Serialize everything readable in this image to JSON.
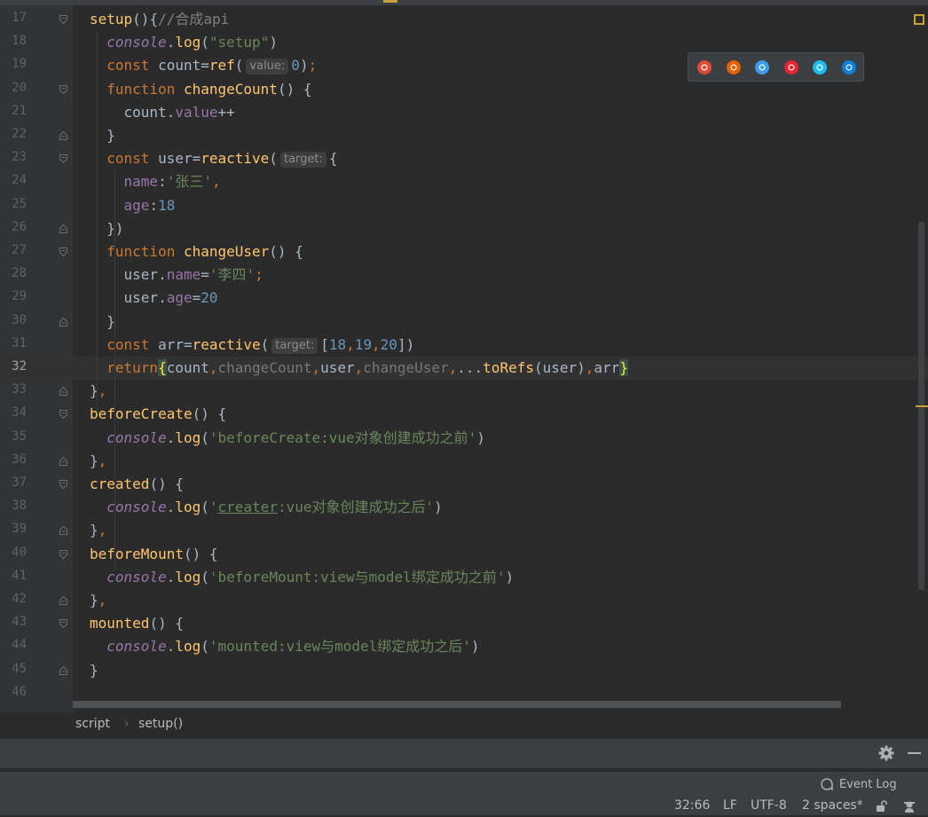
{
  "editor": {
    "current_line": 32,
    "lines": [
      {
        "n": 17,
        "tokens": [
          [
            "fn",
            "setup"
          ],
          [
            "def",
            "(){"
          ],
          [
            "cmt",
            "//合成api"
          ]
        ]
      },
      {
        "n": 18,
        "tokens": [
          [
            "sp",
            "  "
          ],
          [
            "con",
            "console"
          ],
          [
            "def",
            "."
          ],
          [
            "fn",
            "log"
          ],
          [
            "def",
            "("
          ],
          [
            "str",
            "\"setup\""
          ],
          [
            "def",
            ")"
          ]
        ]
      },
      {
        "n": 19,
        "tokens": [
          [
            "sp",
            "  "
          ],
          [
            "kw",
            "const "
          ],
          [
            "def",
            "count="
          ],
          [
            "fn",
            "ref"
          ],
          [
            "def",
            "("
          ],
          [
            "hint",
            "value:"
          ],
          [
            "num",
            "0"
          ],
          [
            "def",
            ")"
          ],
          [
            "kw",
            ";"
          ]
        ]
      },
      {
        "n": 20,
        "tokens": [
          [
            "sp",
            "  "
          ],
          [
            "kw",
            "function "
          ],
          [
            "fn",
            "changeCount"
          ],
          [
            "def",
            "() {"
          ]
        ]
      },
      {
        "n": 21,
        "tokens": [
          [
            "sp",
            "    "
          ],
          [
            "def",
            "count."
          ],
          [
            "prop",
            "value"
          ],
          [
            "def",
            "++"
          ]
        ]
      },
      {
        "n": 22,
        "tokens": [
          [
            "sp",
            "  "
          ],
          [
            "def",
            "}"
          ]
        ]
      },
      {
        "n": 23,
        "tokens": [
          [
            "sp",
            "  "
          ],
          [
            "kw",
            "const "
          ],
          [
            "def",
            "user="
          ],
          [
            "fn",
            "reactive"
          ],
          [
            "def",
            "("
          ],
          [
            "hint",
            "target:"
          ],
          [
            "def",
            "{"
          ]
        ]
      },
      {
        "n": 24,
        "tokens": [
          [
            "sp",
            "    "
          ],
          [
            "prop",
            "name"
          ],
          [
            "def",
            ":"
          ],
          [
            "str",
            "'张三'"
          ],
          [
            "kw",
            ","
          ]
        ]
      },
      {
        "n": 25,
        "tokens": [
          [
            "sp",
            "    "
          ],
          [
            "prop",
            "age"
          ],
          [
            "def",
            ":"
          ],
          [
            "num",
            "18"
          ]
        ]
      },
      {
        "n": 26,
        "tokens": [
          [
            "sp",
            "  "
          ],
          [
            "def",
            "})"
          ]
        ]
      },
      {
        "n": 27,
        "tokens": [
          [
            "sp",
            "  "
          ],
          [
            "kw",
            "function "
          ],
          [
            "fn",
            "changeUser"
          ],
          [
            "def",
            "() {"
          ]
        ]
      },
      {
        "n": 28,
        "tokens": [
          [
            "sp",
            "    "
          ],
          [
            "def",
            "user."
          ],
          [
            "prop",
            "name"
          ],
          [
            "def",
            "="
          ],
          [
            "str",
            "'李四'"
          ],
          [
            "kw",
            ";"
          ]
        ]
      },
      {
        "n": 29,
        "tokens": [
          [
            "sp",
            "    "
          ],
          [
            "def",
            "user."
          ],
          [
            "prop",
            "age"
          ],
          [
            "def",
            "="
          ],
          [
            "num",
            "20"
          ]
        ]
      },
      {
        "n": 30,
        "tokens": [
          [
            "sp",
            "  "
          ],
          [
            "def",
            "}"
          ]
        ]
      },
      {
        "n": 31,
        "tokens": [
          [
            "sp",
            "  "
          ],
          [
            "kw",
            "const "
          ],
          [
            "def",
            "arr="
          ],
          [
            "fn",
            "reactive"
          ],
          [
            "def",
            "("
          ],
          [
            "hint",
            "target:"
          ],
          [
            "def",
            "["
          ],
          [
            "num",
            "18"
          ],
          [
            "kw",
            ","
          ],
          [
            "num",
            "19"
          ],
          [
            "kw",
            ","
          ],
          [
            "num",
            "20"
          ],
          [
            "def",
            "])"
          ]
        ]
      },
      {
        "n": 32,
        "tokens": [
          [
            "sp",
            "  "
          ],
          [
            "kw",
            "return"
          ],
          [
            "hl",
            "{"
          ],
          [
            "def",
            "count"
          ],
          [
            "kw",
            ","
          ],
          [
            "dim",
            "changeCount"
          ],
          [
            "kw",
            ","
          ],
          [
            "def",
            "user"
          ],
          [
            "kw",
            ","
          ],
          [
            "dim",
            "changeUser"
          ],
          [
            "kw",
            ","
          ],
          [
            "def",
            "..."
          ],
          [
            "fn",
            "toRefs"
          ],
          [
            "def",
            "(user)"
          ],
          [
            "kw",
            ","
          ],
          [
            "def",
            "arr"
          ],
          [
            "hl",
            "}"
          ]
        ]
      },
      {
        "n": 33,
        "tokens": [
          [
            "def",
            "}"
          ],
          [
            "kw",
            ","
          ]
        ]
      },
      {
        "n": 34,
        "tokens": [
          [
            "fn",
            "beforeCreate"
          ],
          [
            "def",
            "() {"
          ]
        ]
      },
      {
        "n": 35,
        "tokens": [
          [
            "sp",
            "  "
          ],
          [
            "con",
            "console"
          ],
          [
            "def",
            "."
          ],
          [
            "fn",
            "log"
          ],
          [
            "def",
            "("
          ],
          [
            "str",
            "'beforeCreate:vue对象创建成功之前'"
          ],
          [
            "def",
            ")"
          ]
        ]
      },
      {
        "n": 36,
        "tokens": [
          [
            "def",
            "}"
          ],
          [
            "kw",
            ","
          ]
        ]
      },
      {
        "n": 37,
        "tokens": [
          [
            "fn",
            "created"
          ],
          [
            "def",
            "() {"
          ]
        ]
      },
      {
        "n": 38,
        "tokens": [
          [
            "sp",
            "  "
          ],
          [
            "con",
            "console"
          ],
          [
            "def",
            "."
          ],
          [
            "fn",
            "log"
          ],
          [
            "def",
            "("
          ],
          [
            "str",
            "'"
          ],
          [
            "ul",
            "creater"
          ],
          [
            "str",
            ":vue对象创建成功之后'"
          ],
          [
            "def",
            ")"
          ]
        ]
      },
      {
        "n": 39,
        "tokens": [
          [
            "def",
            "}"
          ],
          [
            "kw",
            ","
          ]
        ]
      },
      {
        "n": 40,
        "tokens": [
          [
            "fn",
            "beforeMount"
          ],
          [
            "def",
            "() {"
          ]
        ]
      },
      {
        "n": 41,
        "tokens": [
          [
            "sp",
            "  "
          ],
          [
            "con",
            "console"
          ],
          [
            "def",
            "."
          ],
          [
            "fn",
            "log"
          ],
          [
            "def",
            "("
          ],
          [
            "str",
            "'beforeMount:view与model绑定成功之前'"
          ],
          [
            "def",
            ")"
          ]
        ]
      },
      {
        "n": 42,
        "tokens": [
          [
            "def",
            "}"
          ],
          [
            "kw",
            ","
          ]
        ]
      },
      {
        "n": 43,
        "tokens": [
          [
            "fn",
            "mounted"
          ],
          [
            "def",
            "() {"
          ]
        ]
      },
      {
        "n": 44,
        "tokens": [
          [
            "sp",
            "  "
          ],
          [
            "con",
            "console"
          ],
          [
            "def",
            "."
          ],
          [
            "fn",
            "log"
          ],
          [
            "def",
            "("
          ],
          [
            "str",
            "'mounted:view与model绑定成功之后'"
          ],
          [
            "def",
            ")"
          ]
        ]
      },
      {
        "n": 45,
        "tokens": [
          [
            "def",
            "}"
          ]
        ]
      },
      {
        "n": 46,
        "tokens": []
      }
    ],
    "folds": {
      "17": "open",
      "20": "open",
      "22": "close",
      "23": "open",
      "26": "close",
      "27": "open",
      "30": "close",
      "33": "close",
      "34": "open",
      "36": "close",
      "37": "open",
      "39": "close",
      "40": "open",
      "42": "close",
      "43": "open",
      "45": "close"
    }
  },
  "browser_icons": [
    {
      "name": "chrome-icon",
      "color": "#dd4b39"
    },
    {
      "name": "firefox-icon",
      "color": "#e66000"
    },
    {
      "name": "safari-icon",
      "color": "#3d9be9"
    },
    {
      "name": "opera-icon",
      "color": "#e3262f"
    },
    {
      "name": "internet-explorer-icon",
      "color": "#1ebbee"
    },
    {
      "name": "edge-icon",
      "color": "#0f7fd6"
    }
  ],
  "breadcrumb": {
    "item1": "script",
    "sep": "›",
    "item2": "setup()"
  },
  "event_log": {
    "label": "Event Log"
  },
  "status": {
    "position": "32:66",
    "line_sep": "LF",
    "encoding": "UTF-8",
    "indent": "2 spaces*"
  },
  "colors": {
    "accent": "#c9a13a",
    "background": "#2b2b2b",
    "gutter": "#313335"
  }
}
